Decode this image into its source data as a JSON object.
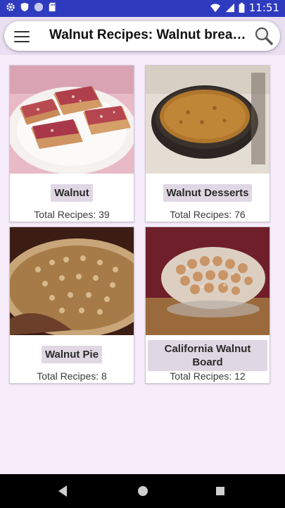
{
  "status_bar": {
    "time": "11:51",
    "left_icons": [
      "settings-icon",
      "shield-icon",
      "circle-icon",
      "sd-card-icon"
    ],
    "right_icons": [
      "wifi-icon",
      "signal-icon",
      "battery-icon"
    ]
  },
  "app_bar": {
    "title": "Walnut Recipes: Walnut bread recipes",
    "menu_icon": "menu-icon",
    "search_icon": "search-icon",
    "accent": "#2f3bbf"
  },
  "categories": [
    {
      "label": "Walnut",
      "count": "Total Recipes: 39"
    },
    {
      "label": "Walnut Desserts",
      "count": "Total Recipes: 76"
    },
    {
      "label": "Walnut Pie",
      "count": "Total Recipes: 8"
    },
    {
      "label": "California Walnut Board",
      "count": "Total Recipes: 12"
    }
  ],
  "nav_bar": {
    "icons": [
      "back-icon",
      "home-icon",
      "recents-icon"
    ]
  }
}
